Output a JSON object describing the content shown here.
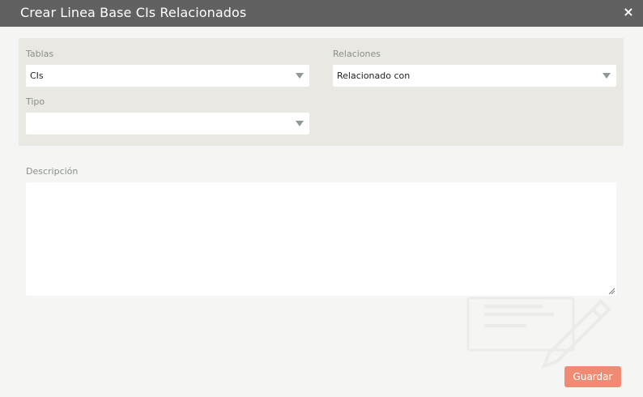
{
  "dialog": {
    "title": "Crear Linea Base CIs Relacionados",
    "close_glyph": "×"
  },
  "form": {
    "tablas": {
      "label": "Tablas",
      "value": "CIs"
    },
    "relaciones": {
      "label": "Relaciones",
      "value": "Relacionado con"
    },
    "tipo": {
      "label": "Tipo",
      "value": ""
    },
    "descripcion": {
      "label": "Descripción",
      "value": ""
    }
  },
  "actions": {
    "save_label": "Guardar"
  },
  "colors": {
    "titlebar": "#616161",
    "panel": "#e9e8e2",
    "accent_button": "#ef8a74",
    "label_text": "#8a9089"
  },
  "icons": {
    "close": "close-icon",
    "dropdown": "chevron-down-icon",
    "resize": "resize-grip-icon",
    "watermark": "edit-document-icon"
  }
}
